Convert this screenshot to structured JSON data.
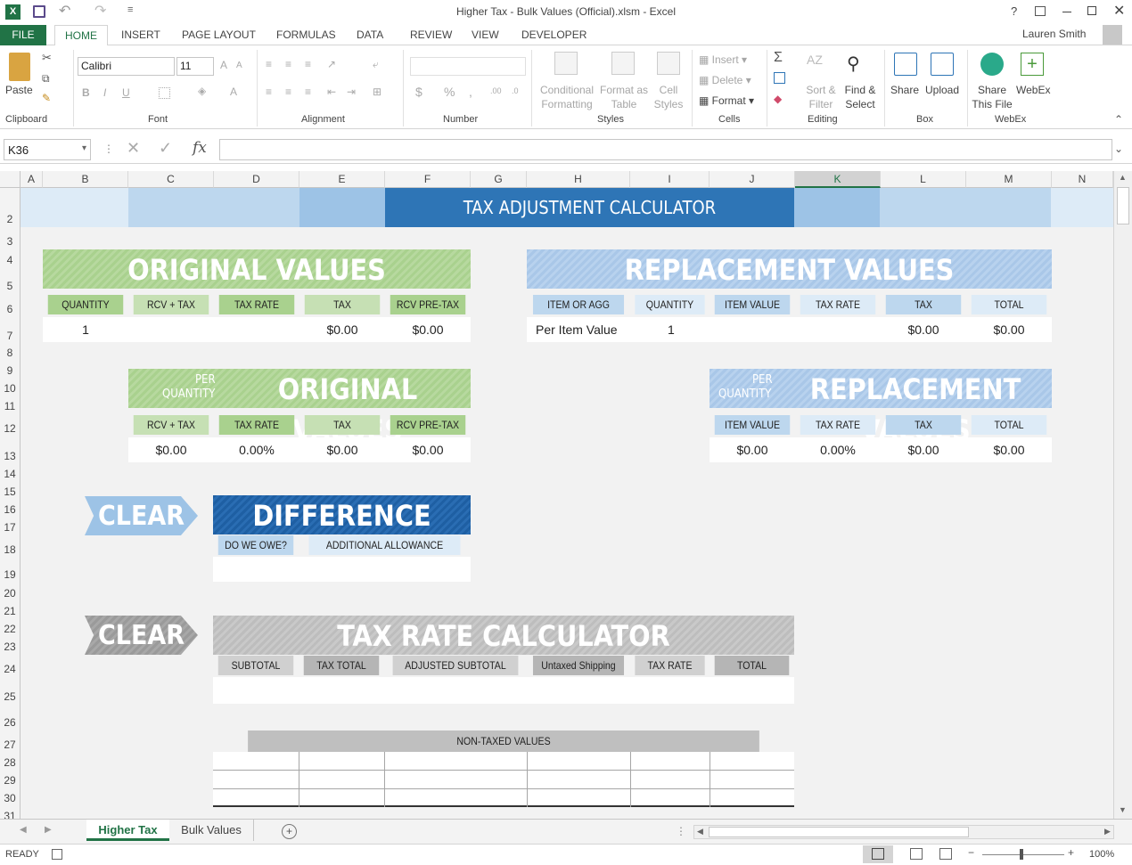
{
  "window": {
    "title": "Higher Tax - Bulk Values (Official).xlsm - Excel",
    "help": "?",
    "user": "Lauren Smith"
  },
  "tabs": [
    "FILE",
    "HOME",
    "INSERT",
    "PAGE LAYOUT",
    "FORMULAS",
    "DATA",
    "REVIEW",
    "VIEW",
    "DEVELOPER"
  ],
  "ribbon": {
    "paste": "Paste",
    "clipboard": "Clipboard",
    "font_name": "Calibri",
    "font_size": "11",
    "font": "Font",
    "alignment": "Alignment",
    "number": "Number",
    "cond_fmt_1": "Conditional",
    "cond_fmt_2": "Formatting",
    "fmt_table_1": "Format as",
    "fmt_table_2": "Table",
    "cell_styles_1": "Cell",
    "cell_styles_2": "Styles",
    "styles": "Styles",
    "insert": "Insert",
    "delete": "Delete",
    "format": "Format",
    "cells": "Cells",
    "sort_1": "Sort &",
    "sort_2": "Filter",
    "find_1": "Find &",
    "find_2": "Select",
    "editing": "Editing",
    "share": "Share",
    "upload": "Upload",
    "box": "Box",
    "share_file_1": "Share",
    "share_file_2": "This File",
    "webex": "WebEx",
    "webex_grp": "WebEx",
    "bold": "B",
    "italic": "I",
    "underline": "U"
  },
  "formula_bar": {
    "name_box": "K36",
    "formula": ""
  },
  "columns": [
    "A",
    "B",
    "C",
    "D",
    "E",
    "F",
    "G",
    "H",
    "I",
    "J",
    "K",
    "L",
    "M",
    "N"
  ],
  "rows": [
    "2",
    "3",
    "4",
    "5",
    "6",
    "7",
    "8",
    "9",
    "10",
    "11",
    "12",
    "13",
    "14",
    "15",
    "16",
    "17",
    "18",
    "19",
    "20",
    "21",
    "22",
    "23",
    "24",
    "25",
    "26",
    "27",
    "28",
    "29",
    "30",
    "31"
  ],
  "sheet": {
    "title": "TAX ADJUSTMENT CALCULATOR",
    "orig": {
      "banner": "ORIGINAL VALUES",
      "headers": [
        "QUANTITY",
        "RCV + TAX",
        "TAX RATE",
        "TAX",
        "RCV PRE-TAX"
      ],
      "values": [
        "1",
        "",
        "",
        "$0.00",
        "$0.00"
      ]
    },
    "repl": {
      "banner": "REPLACEMENT VALUES",
      "headers": [
        "ITEM OR AGG",
        "QUANTITY",
        "ITEM VALUE",
        "TAX RATE",
        "TAX",
        "TOTAL"
      ],
      "values": [
        "Per Item Value",
        "1",
        "",
        "",
        "$0.00",
        "$0.00"
      ]
    },
    "perq_orig": {
      "small1": "PER",
      "small2": "QUANTITY",
      "banner": "ORIGINAL VALUES",
      "headers": [
        "RCV + TAX",
        "TAX RATE",
        "TAX",
        "RCV PRE-TAX"
      ],
      "values": [
        "$0.00",
        "0.00%",
        "$0.00",
        "$0.00"
      ]
    },
    "perq_repl": {
      "small1": "PER",
      "small2": "QUANTITY",
      "banner": "REPLACEMENT VALUES",
      "headers": [
        "ITEM VALUE",
        "TAX RATE",
        "TAX",
        "TOTAL"
      ],
      "values": [
        "$0.00",
        "0.00%",
        "$0.00",
        "$0.00"
      ]
    },
    "clear1": "CLEAR",
    "clear2": "CLEAR",
    "diff": {
      "banner": "DIFFERENCE",
      "headers": [
        "DO WE OWE?",
        "ADDITIONAL ALLOWANCE"
      ]
    },
    "taxrate": {
      "banner": "TAX RATE CALCULATOR",
      "headers": [
        "SUBTOTAL",
        "TAX TOTAL",
        "ADJUSTED SUBTOTAL",
        "Untaxed Shipping",
        "TAX RATE",
        "TOTAL"
      ]
    },
    "nontaxed": "NON-TAXED VALUES"
  },
  "sheet_tabs": [
    "Higher Tax",
    "Bulk Values"
  ],
  "status": {
    "ready": "READY",
    "zoom": "100%"
  },
  "colors": {
    "excel_green": "#217346",
    "blue_dark": "#2e75b6",
    "green_banner": "#a9d18e",
    "blue_banner": "#a9c7e8"
  }
}
